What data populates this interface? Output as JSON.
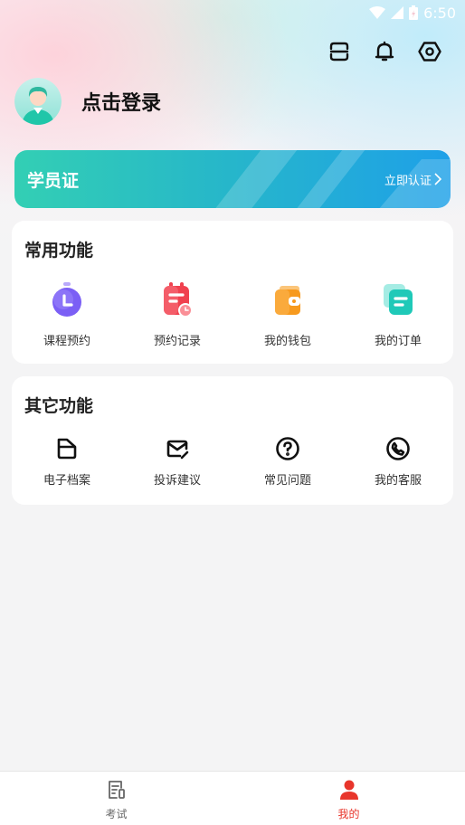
{
  "status_bar": {
    "time": "6:50",
    "icons": [
      "wifi-icon",
      "signal-icon",
      "battery-icon"
    ]
  },
  "header": {
    "icons": [
      "scan-icon",
      "bell-icon",
      "settings-icon"
    ]
  },
  "profile": {
    "login_text": "点击登录",
    "avatar": "avatar-icon"
  },
  "student_card": {
    "title": "学员证",
    "action": "立即认证",
    "gradient": [
      "#33cfb4",
      "#1ea0e8"
    ]
  },
  "common_functions": {
    "title": "常用功能",
    "items": [
      {
        "label": "课程预约",
        "icon": "clock-icon",
        "color": "#7b5ff5"
      },
      {
        "label": "预约记录",
        "icon": "calendar-record-icon",
        "color": "#f0414f"
      },
      {
        "label": "我的钱包",
        "icon": "wallet-icon",
        "color": "#f79a1e"
      },
      {
        "label": "我的订单",
        "icon": "order-icon",
        "color": "#1fc9b8"
      }
    ]
  },
  "other_functions": {
    "title": "其它功能",
    "items": [
      {
        "label": "电子档案",
        "icon": "folder-icon"
      },
      {
        "label": "投诉建议",
        "icon": "mail-edit-icon"
      },
      {
        "label": "常见问题",
        "icon": "question-icon"
      },
      {
        "label": "我的客服",
        "icon": "phone-icon"
      }
    ]
  },
  "tabbar": {
    "tabs": [
      {
        "label": "考试",
        "icon": "exam-icon",
        "active": false
      },
      {
        "label": "我的",
        "icon": "user-icon",
        "active": true
      }
    ],
    "active_color": "#e8352b",
    "inactive_color": "#666666"
  }
}
